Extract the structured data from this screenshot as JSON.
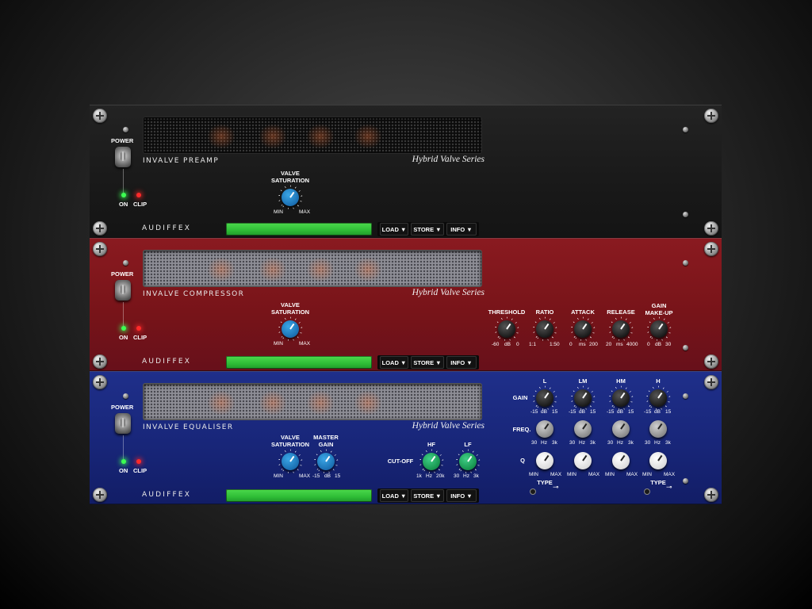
{
  "preamp": {
    "name": "INVALVE PREAMP",
    "series": "Hybrid Valve Series",
    "power_label": "POWER",
    "on_label": "ON",
    "clip_label": "CLIP",
    "knob": {
      "label_1": "VALVE",
      "label_2": "SATURATION",
      "min": "MIN",
      "max": "MAX"
    }
  },
  "compressor": {
    "name": "INVALVE COMPRESSOR",
    "series": "Hybrid Valve Series",
    "power_label": "POWER",
    "on_label": "ON",
    "clip_label": "CLIP",
    "sat": {
      "label_1": "VALVE",
      "label_2": "SATURATION",
      "min": "MIN",
      "max": "MAX"
    },
    "threshold": {
      "label": "THRESHOLD",
      "min": "-60",
      "unit": "dB",
      "max": "0"
    },
    "ratio": {
      "label": "RATIO",
      "min": "1:1",
      "max": "1:50"
    },
    "attack": {
      "label": "ATTACK",
      "min": "0",
      "unit": "ms",
      "max": "200"
    },
    "release": {
      "label": "RELEASE",
      "min": "20",
      "unit": "ms",
      "max": "4000"
    },
    "makeup": {
      "label_1": "GAIN",
      "label_2": "MAKE-UP",
      "min": "0",
      "unit": "dB",
      "max": "30"
    }
  },
  "equaliser": {
    "name": "INVALVE EQUALISER",
    "series": "Hybrid Valve Series",
    "power_label": "POWER",
    "on_label": "ON",
    "clip_label": "CLIP",
    "sat": {
      "label_1": "VALVE",
      "label_2": "SATURATION",
      "min": "MIN",
      "max": "MAX"
    },
    "master": {
      "label_1": "MASTER",
      "label_2": "GAIN",
      "min": "-15",
      "unit": "dB",
      "max": "15"
    },
    "cutoff_label": "CUT-OFF",
    "hf": {
      "label": "HF",
      "min": "1k",
      "unit": "Hz",
      "max": "20k"
    },
    "lf": {
      "label": "LF",
      "min": "30",
      "unit": "Hz",
      "max": "3k"
    },
    "bands": [
      "L",
      "LM",
      "HM",
      "H"
    ],
    "row_labels": {
      "gain": "GAIN",
      "freq": "FREQ.",
      "q": "Q"
    },
    "gain_scale": {
      "min": "-15",
      "unit": "dB",
      "max": "15"
    },
    "freq_scale": {
      "min": "30",
      "unit": "Hz",
      "max": "3k"
    },
    "q_scale": {
      "min": "MIN",
      "max": "MAX"
    },
    "type_label": "TYPE"
  },
  "footer": {
    "brand": "AUDIFFEX",
    "load": "LOAD ▼",
    "store": "STORE ▼",
    "info": "INFO ▼"
  },
  "colors": {
    "preamp_panel": "#1a1a1a",
    "compressor_panel": "#781419",
    "equaliser_panel": "#182679",
    "display_green": "#2ebd36",
    "led_on": "#3cff52",
    "led_clip": "#ff2a2a"
  }
}
